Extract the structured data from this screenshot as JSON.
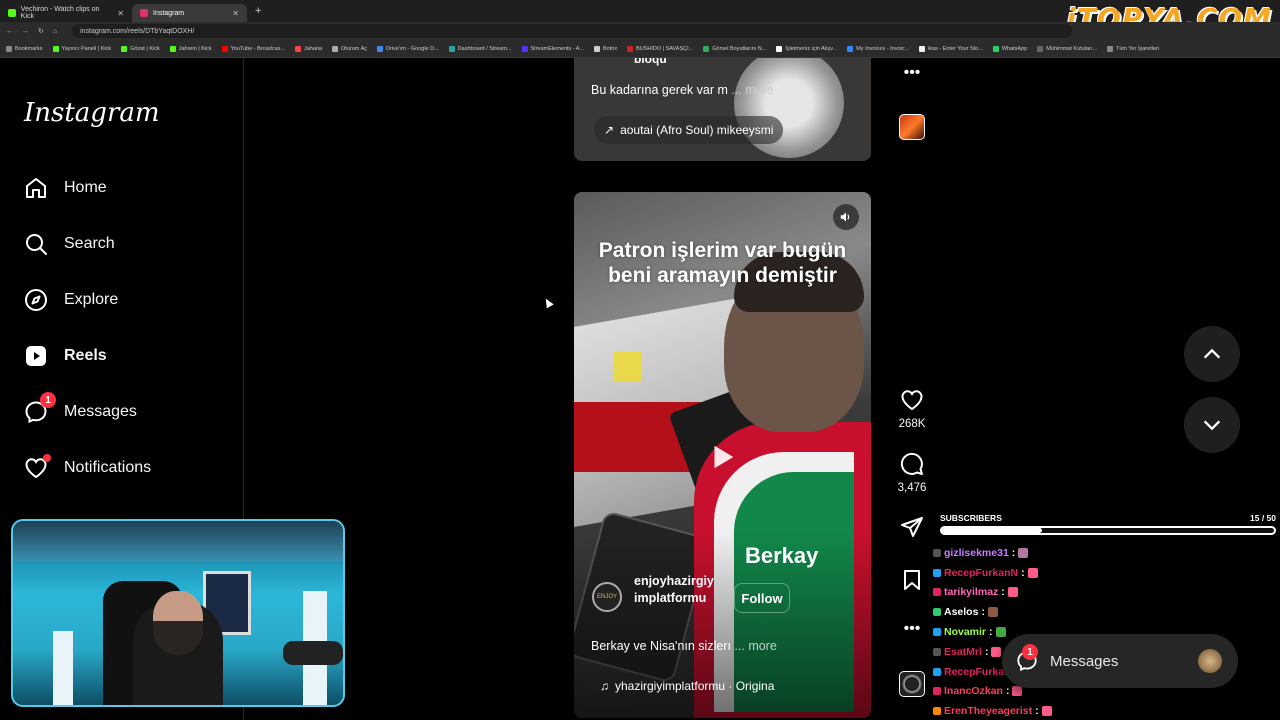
{
  "browser": {
    "tabs": [
      {
        "label": "Vechiron - Watch clips on Kick",
        "favicon_color": "#53fc18",
        "active": false
      },
      {
        "label": "Instagram",
        "favicon_color": "#e1306c",
        "active": true
      }
    ],
    "url": "instagram.com/reels/DTbYaqtDOXH/",
    "bookmarks": [
      {
        "label": "Bookmarks",
        "color": "#888"
      },
      {
        "label": "Yayıncı Paneli | Kick",
        "color": "#53fc18"
      },
      {
        "label": "Gözat | Kick",
        "color": "#53fc18"
      },
      {
        "label": "Jahrein | Kick",
        "color": "#53fc18"
      },
      {
        "label": "YouTube - Broadcas...",
        "color": "#ff0000"
      },
      {
        "label": "Jaharia",
        "color": "#ff4444"
      },
      {
        "label": "Oturum Aç",
        "color": "#aaaaaa"
      },
      {
        "label": "Drive'ım - Google D...",
        "color": "#4285f4"
      },
      {
        "label": "Dashboard / Stream...",
        "color": "#2aa3a3"
      },
      {
        "label": "StreamElements - A...",
        "color": "#5533ff"
      },
      {
        "label": "Botrix",
        "color": "#cccccc"
      },
      {
        "label": "BUSHIDO | SAVAŞÇI...",
        "color": "#cc2222"
      },
      {
        "label": "Görsel Boyutlarını N...",
        "color": "#33aa55"
      },
      {
        "label": "İşletmeniz için Alışv...",
        "color": "#ffffff"
      },
      {
        "label": "My Invoices - Invoic...",
        "color": "#3388ff"
      },
      {
        "label": "ikas - Enter Your Sto...",
        "color": "#eeeeee"
      },
      {
        "label": "WhatsApp",
        "color": "#25d366"
      },
      {
        "label": "Mühimmat Kutuları...",
        "color": "#666666"
      },
      {
        "label": "Tüm Yer İşaretleri",
        "color": "#888888"
      }
    ],
    "watermark": "iTOPYA.COM"
  },
  "sidebar": {
    "logo": "Instagram",
    "items": [
      {
        "label": "Home",
        "icon": "home-icon"
      },
      {
        "label": "Search",
        "icon": "search-icon"
      },
      {
        "label": "Explore",
        "icon": "explore-compass-icon"
      },
      {
        "label": "Reels",
        "icon": "reels-icon",
        "active": true
      },
      {
        "label": "Messages",
        "icon": "messages-icon",
        "badge": "1"
      },
      {
        "label": "Notifications",
        "icon": "heart-icon",
        "dot": true
      }
    ]
  },
  "reel_prev": {
    "username_fragment": "bioqu",
    "caption": "Bu kadarına gerek var m",
    "more": "... more",
    "audio_chip": "aoutai (Afro Soul)  mikeeysmi"
  },
  "reel_current": {
    "overlay_title_line1": "Patron işlerim var bugün",
    "overlay_title_line2": "beni aramayın demiştir",
    "name_overlay": "Berkay",
    "username": "enjoyhazirgiyimplatformu",
    "avatar_label": "ENJOY",
    "follow": "Follow",
    "caption": "Berkay ve Nisa'nın sizlerı",
    "more": "... more",
    "audio": "yhazirgiyimplatformu · Origina"
  },
  "actions": {
    "likes": "268K",
    "comments": "3,476"
  },
  "subscribers": {
    "label": "SUBSCRIBERS",
    "count_text": "15 / 50",
    "progress": 0.3
  },
  "chat": [
    {
      "user": "gizlisekme31",
      "color": "#c77dff",
      "badge_color": "#555555",
      "emote_color": "#b07aa1"
    },
    {
      "user": "RecepFurkanN",
      "color": "#e0245e",
      "badge_color": "#1da1f2",
      "emote_color": "#ff5c8a"
    },
    {
      "user": "tarikyilmaz",
      "color": "#ff69b4",
      "badge_color": "#e0245e",
      "emote_color": "#ff5c8a"
    },
    {
      "user": "Aselos",
      "color": "#ffffff",
      "badge_color": "#2ecc71",
      "emote_color": "#8a5a44"
    },
    {
      "user": "Novamir",
      "color": "#9bff4a",
      "badge_color": "#1da1f2",
      "emote_color": "#44aa44"
    },
    {
      "user": "EsatMrl",
      "color": "#e0245e",
      "badge_color": "#555555",
      "emote_color": "#ff5c8a"
    },
    {
      "user": "RecepFurkanN",
      "color": "#e0245e",
      "badge_color": "#1da1f2",
      "emote_color": "#ff5c8a"
    },
    {
      "user": "InancOzkan",
      "color": "#ff3b5c",
      "badge_color": "#e0245e",
      "emote_color": "#ff5c8a"
    },
    {
      "user": "ErenTheyeagerist",
      "color": "#ff3b5c",
      "badge_color": "#ff8800",
      "emote_color": "#ff5c8a"
    }
  ],
  "messages_pill": {
    "label": "Messages",
    "badge": "1"
  }
}
